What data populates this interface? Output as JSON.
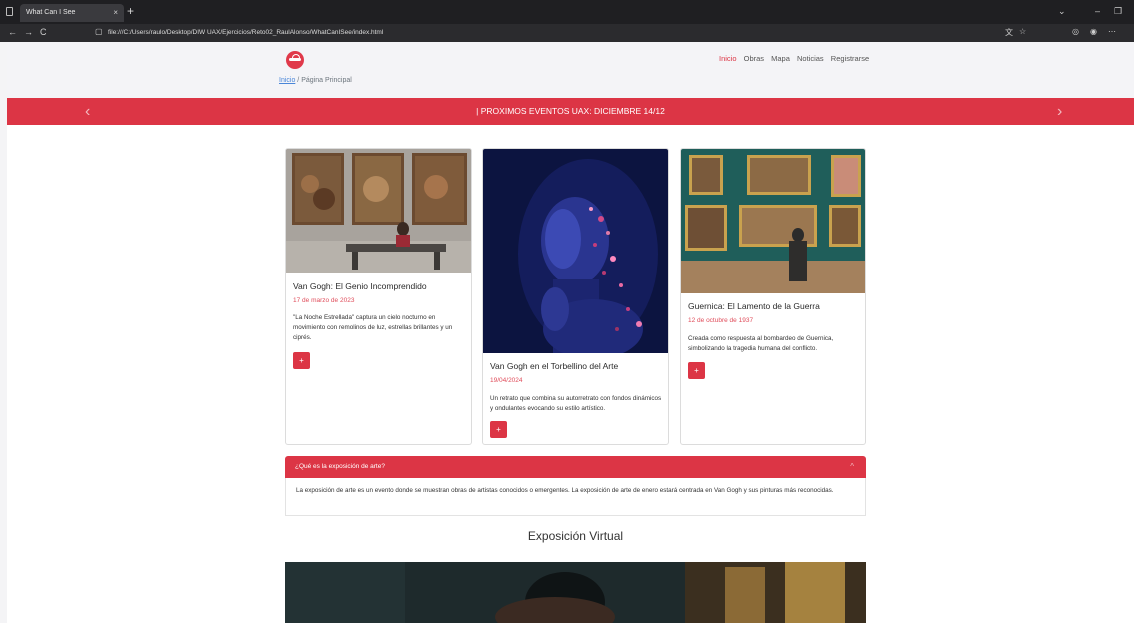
{
  "browser": {
    "tab_title": "What Can I See",
    "tab_close": "×",
    "new_tab": "+",
    "url": "file:///C:/Users/raulo/Desktop/DIW UAX/Ejercicios/Reto02_RaulAlonso/WhatCanISee/index.html",
    "back": "←",
    "forward": "→",
    "reload": "C"
  },
  "nav": {
    "items": [
      "Inicio",
      "Obras",
      "Mapa",
      "Noticias",
      "Registrarse"
    ]
  },
  "breadcrumb": {
    "home": "Inicio",
    "separator": "/",
    "current": "Página Principal"
  },
  "banner": {
    "text": "| PROXIMOS EVENTOS UAX: DICIEMBRE 14/12",
    "prev": "‹",
    "next": "›"
  },
  "cards": [
    {
      "title": "Van Gogh: El Genio Incomprendido",
      "date": "17 de marzo de 2023",
      "text": "\"La Noche Estrellada\" captura un cielo nocturno en movimiento con remolinos de luz, estrellas brillantes y un ciprés.",
      "button": "+"
    },
    {
      "title": "Van Gogh en el Torbellino del Arte",
      "date": "19/04/2024",
      "text": "Un retrato que combina su autorretrato con fondos dinámicos y ondulantes evocando su estilo artístico.",
      "button": "+"
    },
    {
      "title": "Guernica: El Lamento de la Guerra",
      "date": "12 de octubre de 1937",
      "text": "Creada como respuesta al bombardeo de Guernica, simbolizando la tragedia humana del conflicto.",
      "button": "+"
    }
  ],
  "accordion": {
    "question": "¿Qué es la exposición de arte?",
    "chevron": "^",
    "answer": "La exposición de arte es un evento donde se muestran obras de artistas conocidos o emergentes. La exposición de arte de enero estará centrada en Van Gogh y sus pinturas más reconocidas."
  },
  "virtual": {
    "title": "Exposición Virtual"
  },
  "colors": {
    "accent": "#dc3545"
  }
}
